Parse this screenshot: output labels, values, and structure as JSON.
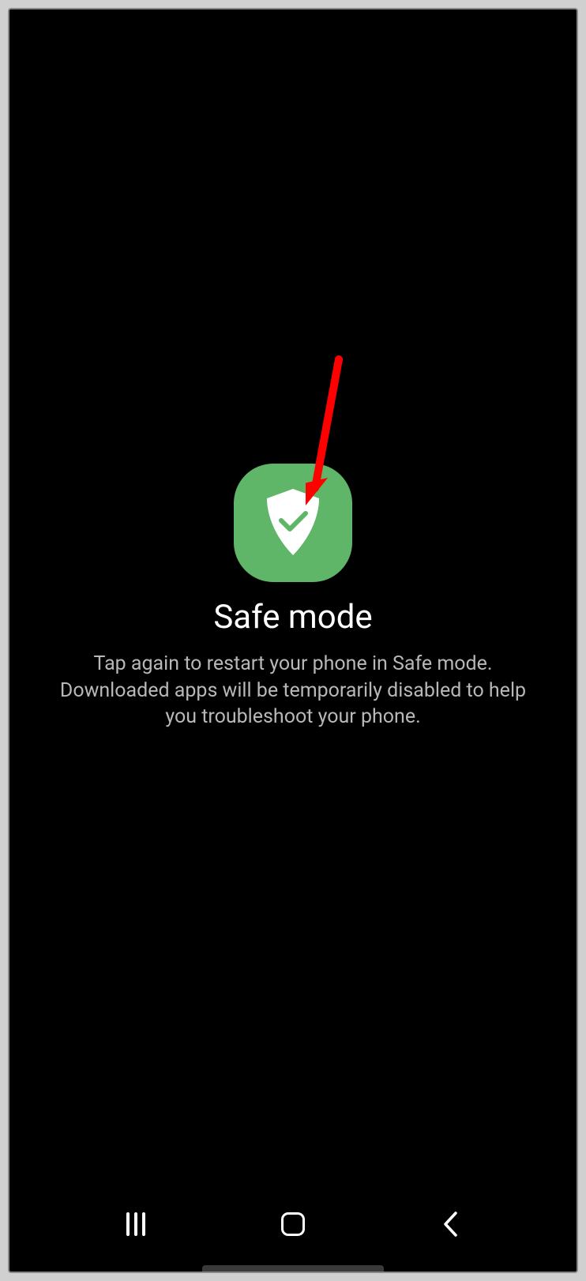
{
  "safemode": {
    "title": "Safe mode",
    "description": "Tap again to restart your phone in Safe mode. Downloaded apps will be temporarily disabled to help you troubleshoot your phone.",
    "icon_color": "#5fb668"
  },
  "annotation": {
    "arrow_color": "#ff0000"
  }
}
